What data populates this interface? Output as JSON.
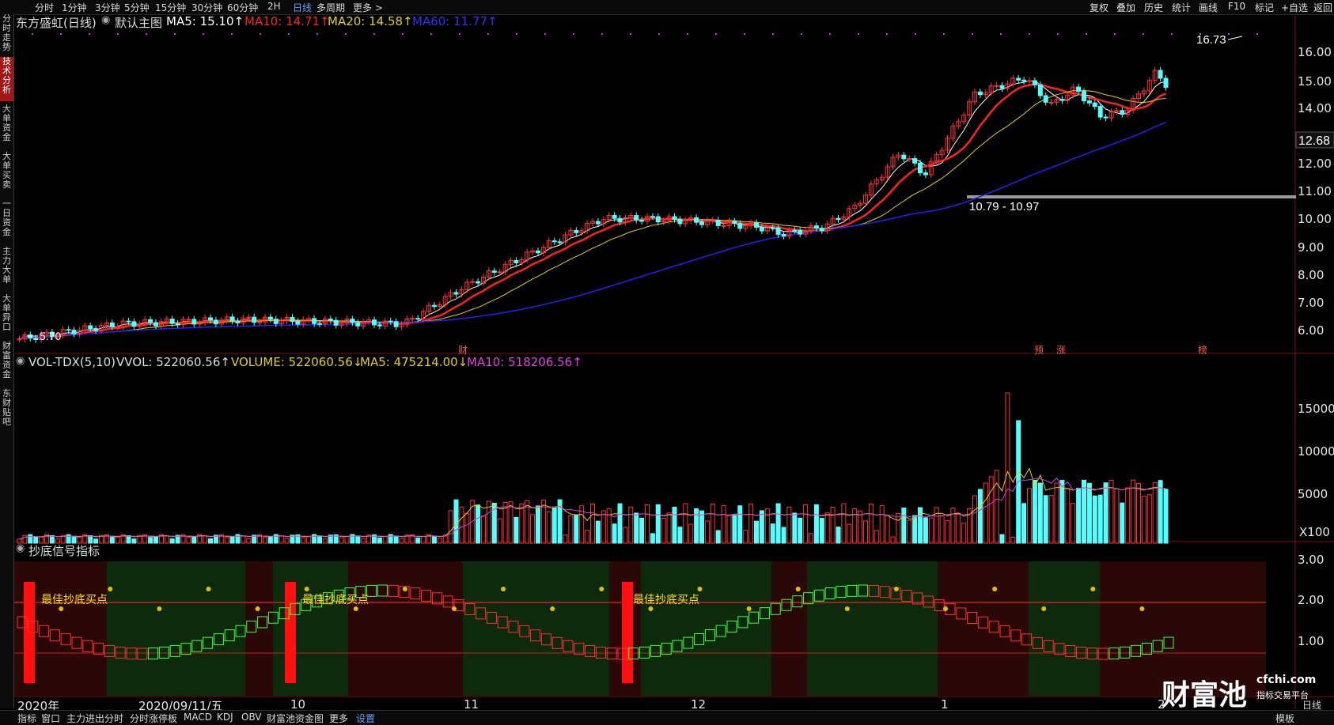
{
  "top_bar": {
    "periods": [
      "分时",
      "1分钟",
      "3分钟",
      "5分钟",
      "15分钟",
      "30分钟",
      "60分钟",
      "2H",
      "日线",
      "多周期",
      "更多 >"
    ],
    "active_period": "日线",
    "right_menu": [
      "复权",
      "叠加",
      "历史",
      "统计",
      "画线",
      "F10",
      "标记",
      "+自选",
      "返回"
    ]
  },
  "sidebar": {
    "tabs": [
      "分时走势",
      "技术分析",
      "大单资金",
      "大单买卖",
      "一日资金",
      "主力大单",
      "大单异口",
      "财富资金",
      "东财贴吧"
    ],
    "active": "技术分析"
  },
  "main_chart": {
    "stock": "东方盛虹(日线)",
    "template": "默认主图",
    "ma5": "MA5: 15.10↑",
    "ma10": "MA10: 14.71↑",
    "ma20": "MA20: 14.58↑",
    "ma60": "MA60: 11.77↑",
    "high_label": "16.73",
    "low_label": "5.70",
    "range_label": "10.79 - 10.97",
    "current_price": "12.68",
    "markers": [
      "财",
      "预",
      "涨",
      "榜"
    ],
    "y_ticks": [
      "16.00",
      "15.00",
      "14.00",
      "12.00",
      "11.00",
      "10.00",
      "9.00",
      "8.00",
      "7.00",
      "6.00"
    ]
  },
  "volume_panel": {
    "name": "VOL-TDX(5,10)",
    "vvol": "VVOL: 522060.56↑",
    "volume": "VOLUME: 522060.56↓",
    "ma5": "MA5: 475214.00↓",
    "ma10": "MA10: 518206.56↑",
    "y_ticks": [
      "15000",
      "10000",
      "5000"
    ],
    "unit": "X100"
  },
  "signal_panel": {
    "name": "抄底信号指标",
    "labels": [
      "最佳抄底买点",
      "最佳抄底买点",
      "最佳抄底买点"
    ],
    "y_ticks": [
      "3.00",
      "2.00",
      "1.00"
    ]
  },
  "x_axis": {
    "labels": [
      "2020年",
      "2020/09/11/五",
      "10",
      "11",
      "12",
      "1",
      "2"
    ]
  },
  "bottom_bar": {
    "tabs": [
      "指标",
      "窗口",
      "主力进出分时",
      "分时涨停板",
      "MACD",
      "KDJ",
      "OBV",
      "财富池资金图",
      "更多",
      "设置"
    ],
    "active": "设置",
    "right": [
      "模板",
      "日线"
    ]
  },
  "watermark": {
    "brand": "财富池",
    "url": "cfchi.com",
    "slogan": "指标交易平台"
  },
  "colors": {
    "ma5": "#ffffff",
    "ma10": "#ff2020",
    "ma20": "#e6d200",
    "ma60": "#2020ff",
    "up": "#ff3232",
    "down": "#54ffff",
    "grid": "#7a1010"
  }
}
